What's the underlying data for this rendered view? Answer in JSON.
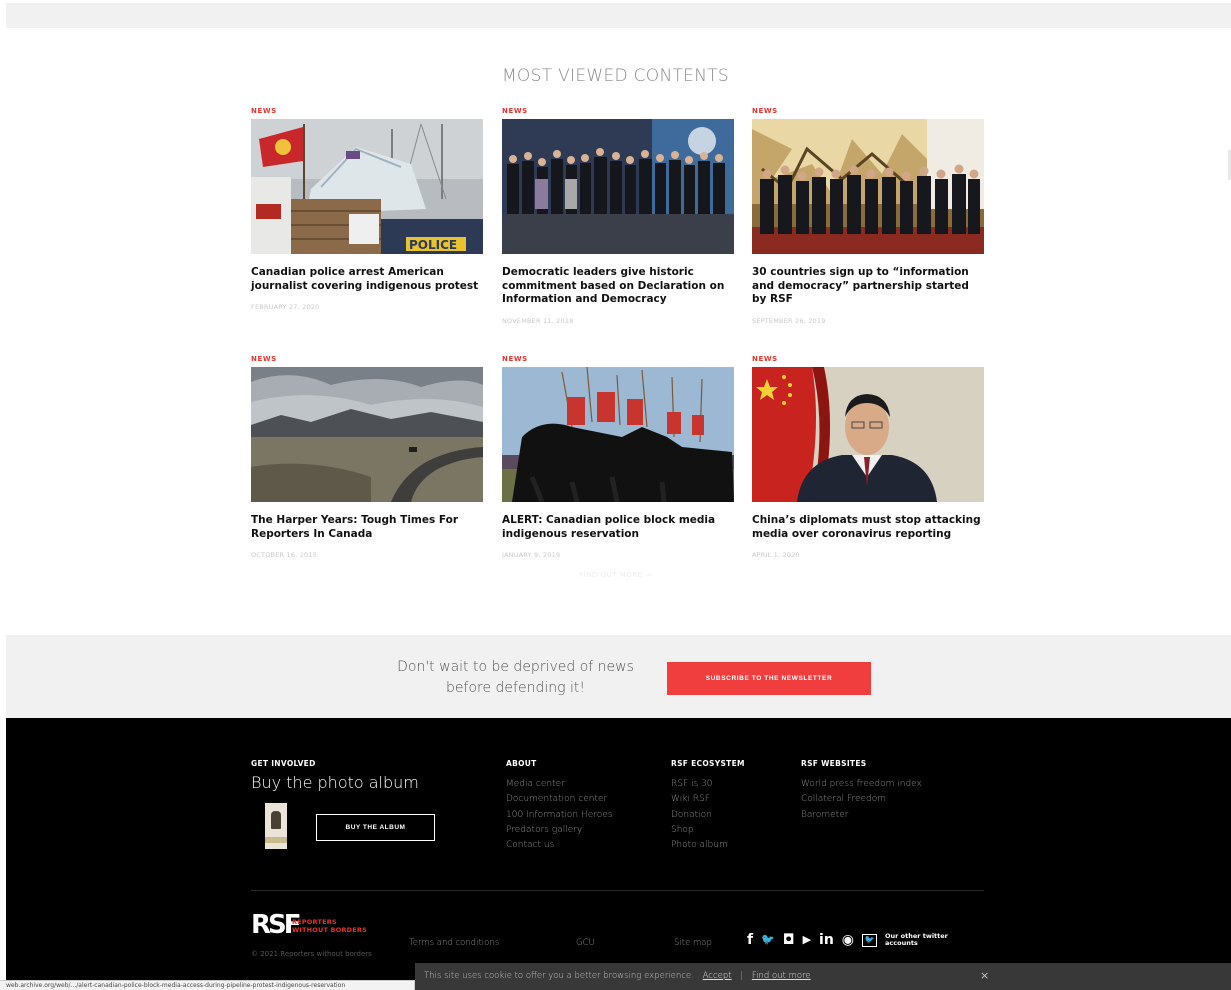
{
  "section": {
    "title": "MOST VIEWED CONTENTS"
  },
  "cards": [
    {
      "tag": "NEWS",
      "headline": "Canadian police arrest American journalist covering indigenous protest",
      "date": "FEBRUARY 27, 2020"
    },
    {
      "tag": "NEWS",
      "headline": "Democratic leaders give historic commitment based on Declaration on Information and Democracy",
      "date": "NOVEMBER 11, 2018"
    },
    {
      "tag": "NEWS",
      "headline": "30 countries sign up to “information and democracy” partnership started by RSF",
      "date": "SEPTEMBER 26, 2019"
    },
    {
      "tag": "NEWS",
      "headline": "The Harper Years: Tough Times For Reporters In Canada",
      "date": "OCTOBER 16, 2015"
    },
    {
      "tag": "NEWS",
      "headline": "ALERT: Canadian police block media indigenous reservation",
      "date": "JANUARY 9, 2019"
    },
    {
      "tag": "NEWS",
      "headline": "China’s diplomats must stop attacking media over coronavirus reporting",
      "date": "APRIL 1, 2020"
    }
  ],
  "find_more": "FIND OUT MORE →",
  "newsletter": {
    "text": "Don't wait to be deprived of news before defending it!",
    "button": "SUBSCRIBE TO THE NEWSLETTER"
  },
  "footer": {
    "get_involved": {
      "heading": "GET INVOLVED",
      "title": "Buy the photo album",
      "button": "BUY THE ALBUM"
    },
    "about": {
      "heading": "ABOUT",
      "items": [
        "Media center",
        "Documentation center",
        "100 Information Heroes",
        "Predators gallery",
        "Contact us"
      ]
    },
    "ecosystem": {
      "heading": "RSF ECOSYSTEM",
      "items": [
        "RSF is 30",
        "Wiki RSF",
        "Donation",
        "Shop",
        "Photo album"
      ]
    },
    "websites": {
      "heading": "RSF WEBSITES",
      "items": [
        "World press freedom index",
        "Collateral Freedom",
        "Barometer"
      ]
    },
    "logo": {
      "mark": "RSF",
      "line1": "REPORTERS",
      "line2": "WITHOUT BORDERS",
      "copyright": "© 2021 Reporters without borders"
    },
    "links": {
      "terms": "Terms and conditions",
      "gcu": "GCU",
      "sitemap": "Site map"
    },
    "social": {
      "icons": [
        "facebook-icon",
        "twitter-icon",
        "instagram-icon",
        "youtube-icon",
        "linkedin-icon",
        "rss-icon",
        "twitter-box-icon"
      ],
      "other_twitter": "Our other twitter accounts",
      "glyphs": {
        "facebook": "f",
        "twitter": "🐦",
        "instagram": "◘",
        "youtube": "▶",
        "linkedin": "in",
        "rss": "◉",
        "box": "🐦"
      }
    }
  },
  "cookie": {
    "message": "This site uses cookie to offer you a better browsing experience.",
    "accept": "Accept",
    "separator": "|",
    "find_out_more": "Find out more",
    "close": "×"
  },
  "status_url": "web.archive.org/web/.../alert-canadian-police-block-media-access-during-pipeline-protest-indigenous-reservation",
  "colors": {
    "accent": "#e6342e",
    "button_red": "#f03e3e",
    "footer_bg": "#000000",
    "light_bg": "#f1f1f2"
  }
}
